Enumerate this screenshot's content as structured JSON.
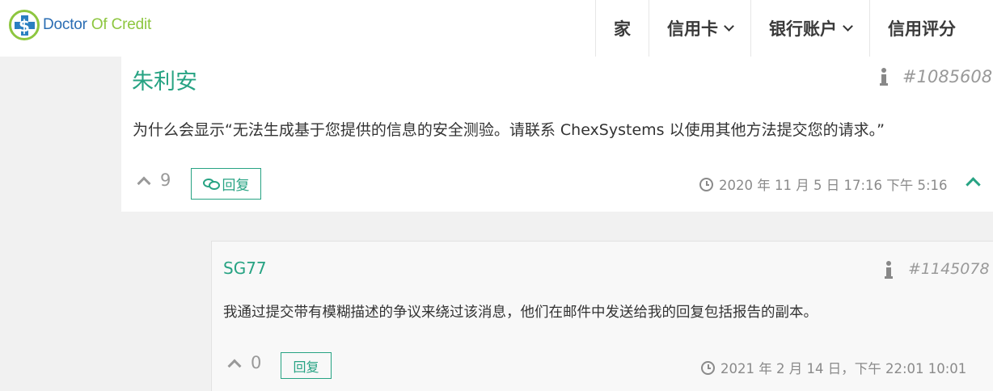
{
  "logo": {
    "part1": "Doctor ",
    "part2": "Of Credit",
    "badge_symbol": "$"
  },
  "nav": {
    "items": [
      {
        "label": "家",
        "has_dropdown": false
      },
      {
        "label": "信用卡",
        "has_dropdown": true
      },
      {
        "label": "银行账户",
        "has_dropdown": true
      },
      {
        "label": "信用评分",
        "has_dropdown": false
      }
    ]
  },
  "comments": [
    {
      "author": "朱利安",
      "id": "#1085608",
      "text": "为什么会显示“无法生成基于您提供的信息的安全测验。请联系 ChexSystems 以使用其他方法提交您的请求。”",
      "votes": "9",
      "reply_label": "回复",
      "timestamp": "2020 年 11 月 5 日 17:16 下午 5:16"
    },
    {
      "author": "SG77",
      "id": "#1145078",
      "text": "我通过提交带有模糊描述的争议来绕过该消息，他们在邮件中发送给我的回复包括报告的副本。",
      "votes": "0",
      "reply_label": "回复",
      "timestamp": "2021 年 2 月 14 日，下午 22:01 10:01"
    }
  ],
  "colors": {
    "accent": "#27a383",
    "logo_blue": "#2a6db3",
    "logo_green": "#8dc63f",
    "muted": "#999999"
  },
  "icons": [
    "info-icon",
    "chevron-up-icon",
    "chat-bubbles-icon",
    "clock-icon",
    "chevron-down-icon"
  ]
}
